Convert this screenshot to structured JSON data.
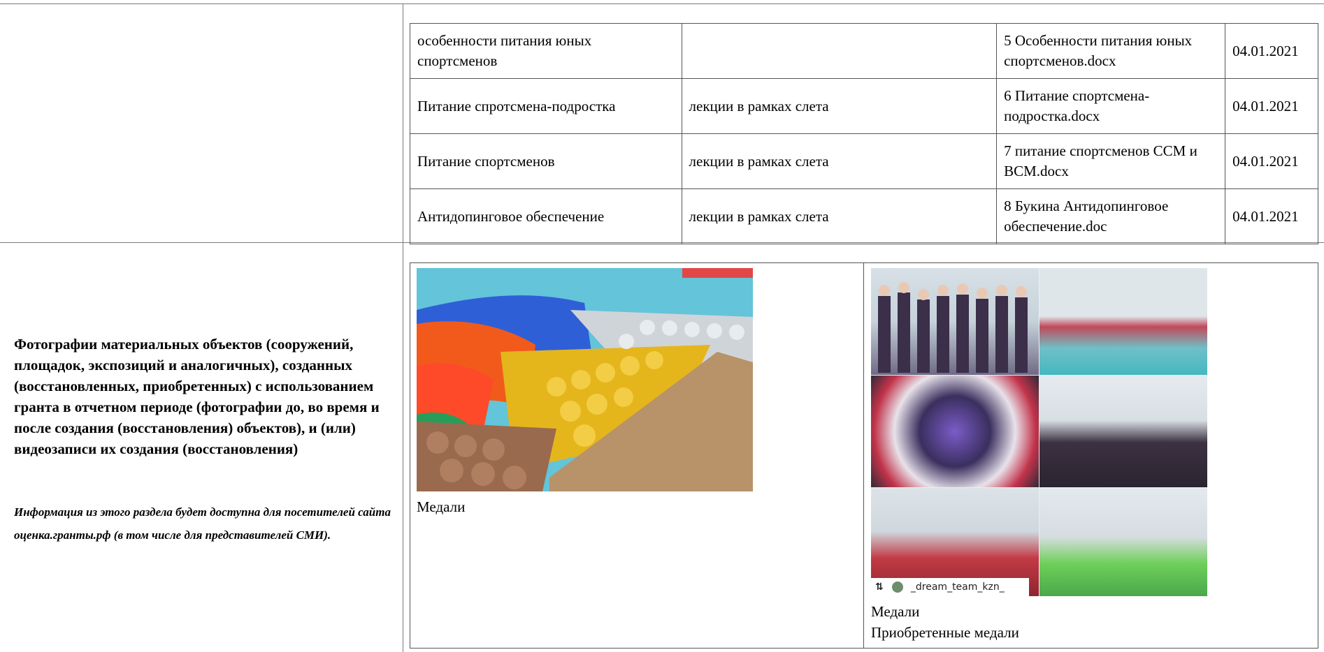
{
  "table": {
    "rows": [
      {
        "name": "особенности питания юных спортсменов",
        "type": "",
        "file": "5 Особенности питания юных спортсменов.docx",
        "date": "04.01.2021"
      },
      {
        "name": "Питание спротсмена-подростка",
        "type": "лекции в рамках слета",
        "file": "6 Питание спортсмена-подростка.docx",
        "date": "04.01.2021"
      },
      {
        "name": "Питание спортсменов",
        "type": "лекции в рамках слета",
        "file": "7 питание спортсменов ССМ и ВСМ.docx",
        "date": "04.01.2021"
      },
      {
        "name": "Антидопинговое обеспечение",
        "type": "лекции в рамках слета",
        "file": "8 Букина Антидопинговое обеспечение.doc",
        "date": "04.01.2021"
      }
    ]
  },
  "photos_section": {
    "heading": "Фотографии материальных объектов (сооружений, площадок, экспозиций и аналогичных), созданных (восстановленных, приобретенных) с использованием гранта в отчетном периоде (фотографии до, во время и после создания (восстановления) объектов), и (или) видеозаписи их создания (восстановления)",
    "note": "Информация из этого раздела будет доступна для посетителей сайта оценка.гранты.рф (в том числе для представителей СМИ).",
    "photos": [
      {
        "caption": "Медали",
        "description": ""
      },
      {
        "caption": "Медали",
        "description": "Приобретенные медали",
        "watermark": "_dream_team_kzn_"
      }
    ]
  },
  "colors": {
    "border": "#7a7a7a",
    "text": "#000000"
  }
}
